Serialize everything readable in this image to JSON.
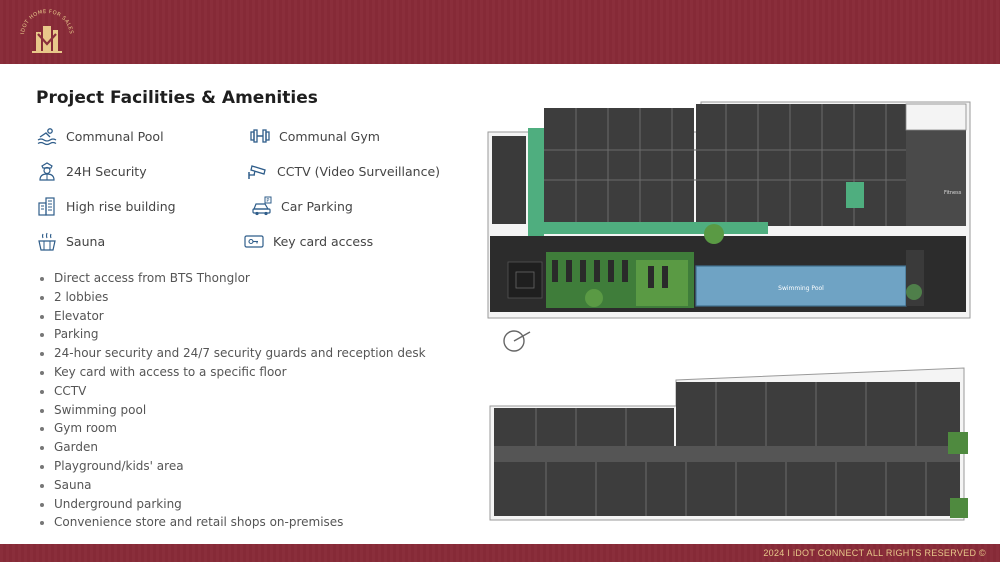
{
  "header": {
    "logo_text": "IDOT HOME FOR SALES"
  },
  "title": "Project Facilities & Amenities",
  "amenities": [
    {
      "label": "Communal Pool",
      "icon": "pool-icon"
    },
    {
      "label": "Communal Gym",
      "icon": "dumbbell-icon"
    },
    {
      "label": "24H Security",
      "icon": "security-guard-icon"
    },
    {
      "label": "CCTV (Video Surveillance)",
      "icon": "cctv-icon"
    },
    {
      "label": "High rise building",
      "icon": "building-icon"
    },
    {
      "label": "Car Parking",
      "icon": "car-icon"
    },
    {
      "label": "Sauna",
      "icon": "sauna-icon"
    },
    {
      "label": "Key card access",
      "icon": "keycard-icon"
    }
  ],
  "features": [
    "Direct access from BTS Thonglor",
    "2 lobbies",
    "Elevator",
    "Parking",
    "24-hour security and 24/7 security guards and reception desk",
    "Key card with access to a specific floor",
    "CCTV",
    "Swimming pool",
    "Gym room",
    "Garden",
    "Playground/kids' area",
    "Sauna",
    "Underground parking",
    "Convenience store and retail shops on-premises"
  ],
  "floor_plan_top": {
    "pool_label": "Swimming Pool",
    "gym_label": "Fitness"
  },
  "footer": {
    "copyright": "2024 I iDOT CONNECT  ALL  RIGHTS RESERVED  ©"
  },
  "colors": {
    "brand_maroon": "#8a2e3b",
    "brand_gold": "#e8c88a",
    "icon_blue": "#2f5d8a",
    "plan_dark": "#3d3d3d",
    "plan_green": "#4fae7f",
    "pool_blue": "#6fa3c4"
  }
}
